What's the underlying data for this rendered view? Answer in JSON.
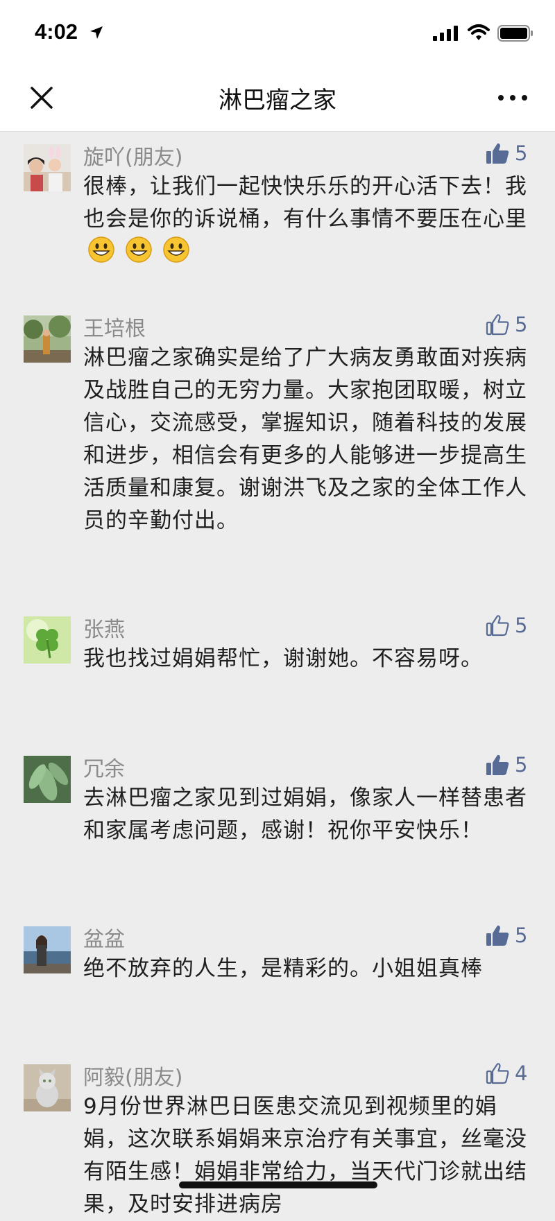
{
  "status_bar": {
    "time": "4:02"
  },
  "nav": {
    "title": "淋巴瘤之家"
  },
  "comments": [
    {
      "name": "旋吖(朋友)",
      "likes": "5",
      "liked": true,
      "text": "很棒，让我们一起快快乐乐的开心活下去！我也会是你的诉说桶，有什么事情不要压在心里",
      "emoji_count": 3
    },
    {
      "name": "王培根",
      "likes": "5",
      "liked": false,
      "text": "淋巴瘤之家确实是给了广大病友勇敢面对疾病及战胜自己的无穷力量。大家抱团取暖，树立信心，交流感受，掌握知识，随着科技的发展和进步，相信会有更多的人能够进一步提高生活质量和康复。谢谢洪飞及之家的全体工作人员的辛勤付出。"
    },
    {
      "name": "张燕",
      "likes": "5",
      "liked": false,
      "text": "我也找过娟娟帮忙，谢谢她。不容易呀。"
    },
    {
      "name": "冗余",
      "likes": "5",
      "liked": true,
      "text": "去淋巴瘤之家见到过娟娟，像家人一样替患者和家属考虑问题，感谢！祝你平安快乐！"
    },
    {
      "name": "盆盆",
      "likes": "5",
      "liked": true,
      "text": "绝不放弃的人生，是精彩的。小姐姐真棒"
    },
    {
      "name": "阿毅(朋友)",
      "likes": "4",
      "liked": false,
      "text": "9月份世界淋巴日医患交流见到视频里的娟娟，这次联系娟娟来京治疗有关事宜，丝毫没有陌生感！娟娟非常给力，当天代门诊就出结果，及时安排进病房"
    }
  ]
}
